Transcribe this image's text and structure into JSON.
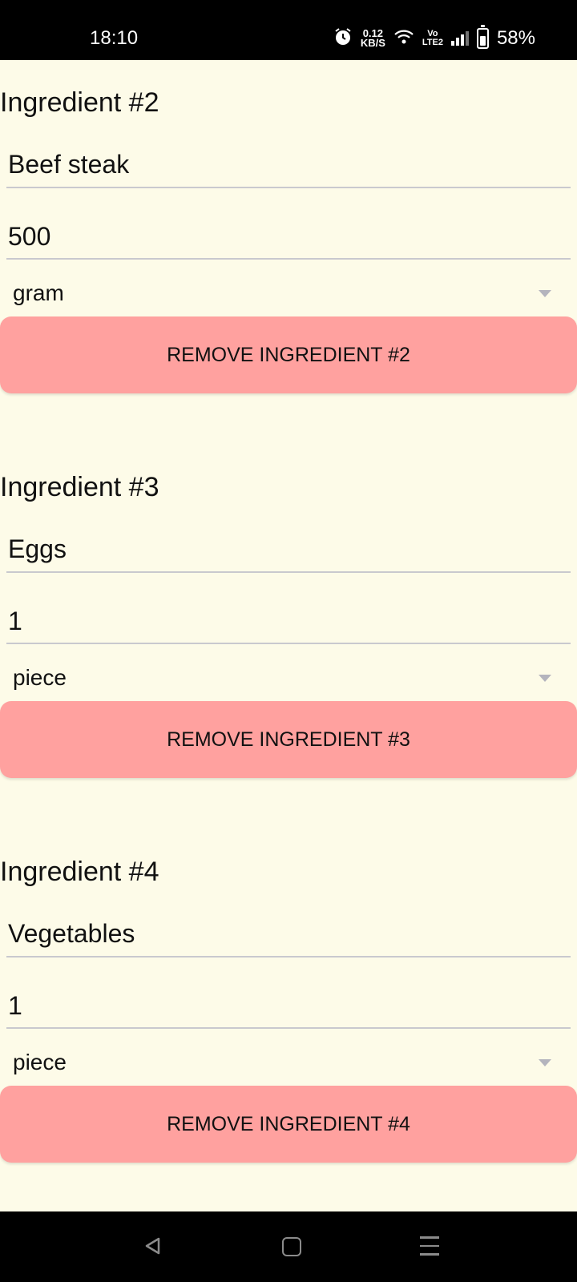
{
  "status_bar": {
    "time": "18:10",
    "net_speed_value": "0.12",
    "net_speed_unit": "KB/S",
    "volte_top": "Vo",
    "volte_bottom": "LTE2",
    "battery": "58%",
    "icons": [
      "alarm-icon",
      "wifi-icon",
      "signal-icon",
      "battery-icon"
    ]
  },
  "ingredients": [
    {
      "heading": "Ingredient #2",
      "name": "Beef steak",
      "quantity": "500",
      "unit": "gram",
      "remove_label": "REMOVE INGREDIENT #2"
    },
    {
      "heading": "Ingredient #3",
      "name": "Eggs",
      "quantity": "1",
      "unit": "piece",
      "remove_label": "REMOVE INGREDIENT #3"
    },
    {
      "heading": "Ingredient #4",
      "name": "Vegetables",
      "quantity": "1",
      "unit": "piece",
      "remove_label": "REMOVE INGREDIENT #4"
    }
  ],
  "colors": {
    "background": "#fdfbe8",
    "remove_button": "#ffa19f",
    "underline": "#c9c9ce"
  },
  "nav_bar": {
    "icons": [
      "back-icon",
      "home-icon",
      "recents-icon"
    ]
  }
}
